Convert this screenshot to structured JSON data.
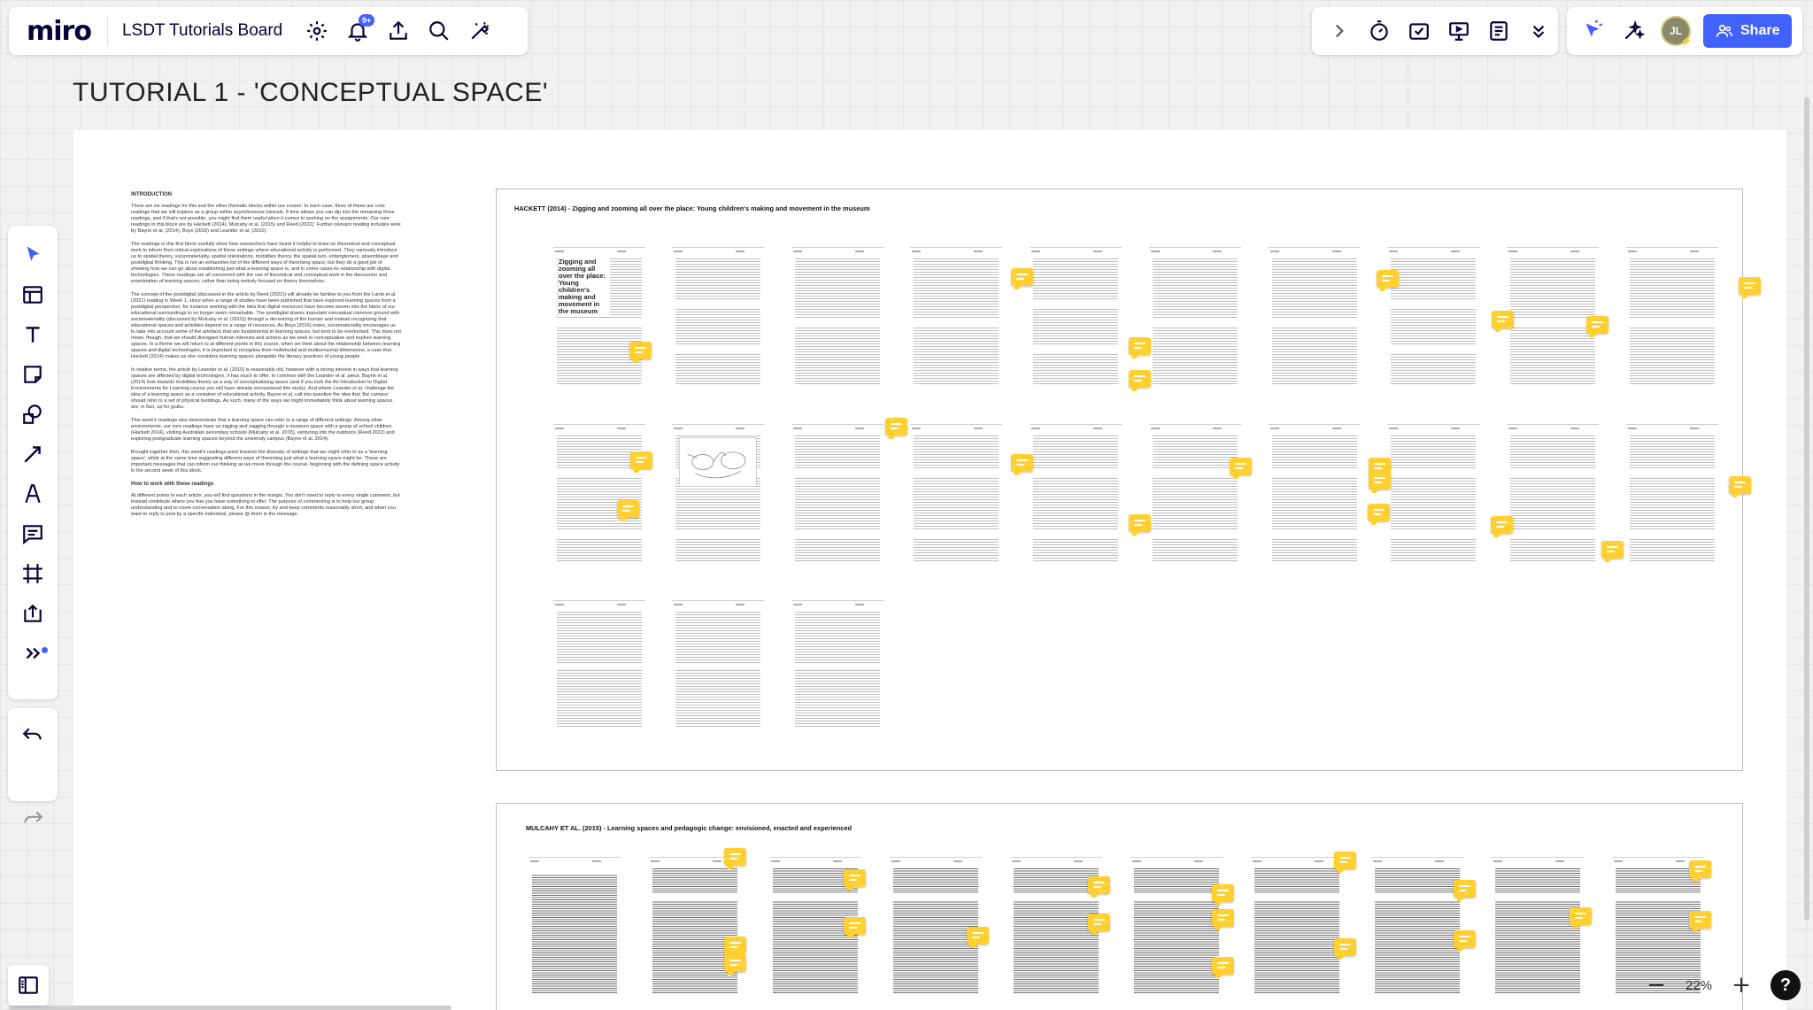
{
  "app": {
    "logo": "miro",
    "board_name": "LSDT Tutorials Board",
    "notification_count": "9+"
  },
  "header_right": {
    "share_label": "Share",
    "avatar_initials": "JL"
  },
  "canvas": {
    "title": "TUTORIAL 1 - 'CONCEPTUAL SPACE'",
    "intro": {
      "heading": "INTRODUCTION",
      "paragraphs": [
        "There are six readings for this and the other thematic blocks within our course. In each case, three of these are core readings that we will explore as a group within asynchronous tutorials. If time allows you can dip into the remaining three readings, and if that's not possible, you might find them useful when it comes to working on the assignments. Our core readings in this block are by Hackett (2014), Mulcahy et al. (2015) and Reed (2022). Further relevant reading includes work by Bayne et al. (2014), Boys (2016) and Leander et al. (2010).",
        "The readings in this first block usefully show how researchers have found it helpful to draw on theoretical and conceptual work to inform their critical explorations of these settings where educational activity is performed. They variously introduce us to spatial theory, sociomateriality, spatial orientations, mobilities theory, the spatial turn, entanglement, assemblage and postdigital thinking. This is not an exhaustive list of the different ways of theorising space, but they do a good job of showing how we can go about establishing just what a learning space is, and in some cases its relationship with digital technologies. These readings are all concerned with the use of theoretical and conceptual work in the discussion and examination of learning spaces, rather than being entirely focused on theory themselves.",
        "The concept of the postdigital (discussed in the article by Reed (2022)) will already be familiar to you from the Lamb et al. (2021) reading in Week 1, since when a range of studies have been published that have explored learning spaces from a postdigital perspective, for instance working with the idea that digital resources have become woven into the fabric of our educational surroundings to no longer seem remarkable. The postdigital shares important conceptual common ground with sociomateriality (discussed by Mulcahy et al. (2015)) through a decentring of the human and instead recognising that educational spaces and activities depend on a range of resources. As Boys (2016) notes, sociomateriality encourages us to take into account some of the artefacts that are fundamental to learning spaces, but tend to be overlooked. This does not mean, though, that we should disregard human interests and actions as we seek to conceptualise and explore learning spaces. In a theme we will return to at different points in this course, when we think about the relationship between learning spaces and digital technologies, it is important to recognise their multimodal and multisensorial dimensions, a case that Hackett (2014) makes as she considers learning spaces alongside the literacy practices of young people.",
        "In relative terms, the article by Leander et al. (2010) is reasonably old, however with a strong interest in ways that learning spaces are affected by digital technologies, it has much to offer. In common with the Leander et al. piece, Bayne et al. (2014) look towards mobilities theory as a way of conceptualising space (and if you took the An Introduction to Digital Environments for Learning course you will have already encountered this study). And where Leander et al. challenge the idea of a learning space as a container of educational activity, Bayne et al. call into question the idea that 'the campus' should refer to a set of physical buildings. As such, many of the ways we might immediately think about learning spaces are, in fact, up for grabs.",
        "This week's readings also demonstrate that a learning space can refer to a range of different settings. Among other environments, our core readings have us zigging and zagging through a museum space with a group of school children (Hackett 2014), visiting Australian secondary schools (Mulcahy et al. 2015), venturing into the outdoors (Reed 2022) and exploring postgraduate learning spaces beyond the university campus (Bayne et al. 2014).",
        "Brought together then, this week's readings point towards the diversity of settings that we might refer to as a 'learning space', while at the same time suggesting different ways of theorising just what a learning space might be. These are important messages that can inform our thinking as we move through the course, beginning with the defining space activity in the second week of this block."
      ],
      "subheading": "How to work with these readings",
      "closing": "At different points in each article, you will find questions in the margin. You don't need to reply to every single comment, but instead contribute where you feel you have something to offer. The purpose of commenting is to help our group understanding and to move conversation along. For this reason, try and keep comments reasonably short, and when you want to reply to post by a specific individual, please @ them in the message."
    },
    "articles": [
      {
        "title": "HACKETT (2014) - Zigging and zooming all over the place: Young children's making and movement in the museum",
        "cover_title": "Zigging and zooming all over the place: Young children's making and movement in the museum"
      },
      {
        "title": "MULCAHY ET AL. (2015) - Learning spaces and pedagogic change: envisioned, enacted and experienced"
      }
    ]
  },
  "zoom": {
    "level": "22%"
  },
  "colors": {
    "accent": "#4262ff",
    "comment": "#ffd02f",
    "logo": "#050038"
  },
  "icons": {
    "top_left": [
      "settings-icon",
      "notifications-icon",
      "export-icon",
      "search-icon",
      "magic-icon"
    ],
    "top_right": [
      "expand-chevron-icon",
      "timer-icon",
      "voting-icon",
      "presentation-icon",
      "notes-icon",
      "more-chevron-icon",
      "reactions-icon",
      "ai-icon"
    ],
    "toolbar": [
      "select-icon",
      "templates-icon",
      "text-icon",
      "sticky-note-icon",
      "shapes-icon",
      "connector-icon",
      "pen-icon",
      "comment-icon",
      "frame-icon",
      "upload-icon",
      "more-tools-icon",
      "undo-icon",
      "redo-icon"
    ]
  }
}
